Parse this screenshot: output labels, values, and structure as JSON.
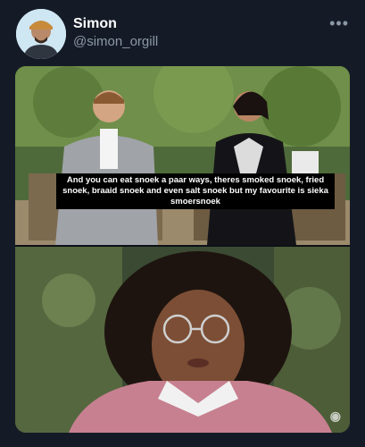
{
  "user": {
    "name": "Simon",
    "handle": "@simon_orgill"
  },
  "menu": {
    "more_label": "•••"
  },
  "media": {
    "caption": "And you can eat snoek a paar ways, theres smoked snoek, fried snoek, braaid snoek and even salt snoek but my favourite is sieka smoersnoek"
  },
  "colors": {
    "background": "#151b26",
    "name": "#ffffff",
    "handle": "#8b98a5"
  }
}
